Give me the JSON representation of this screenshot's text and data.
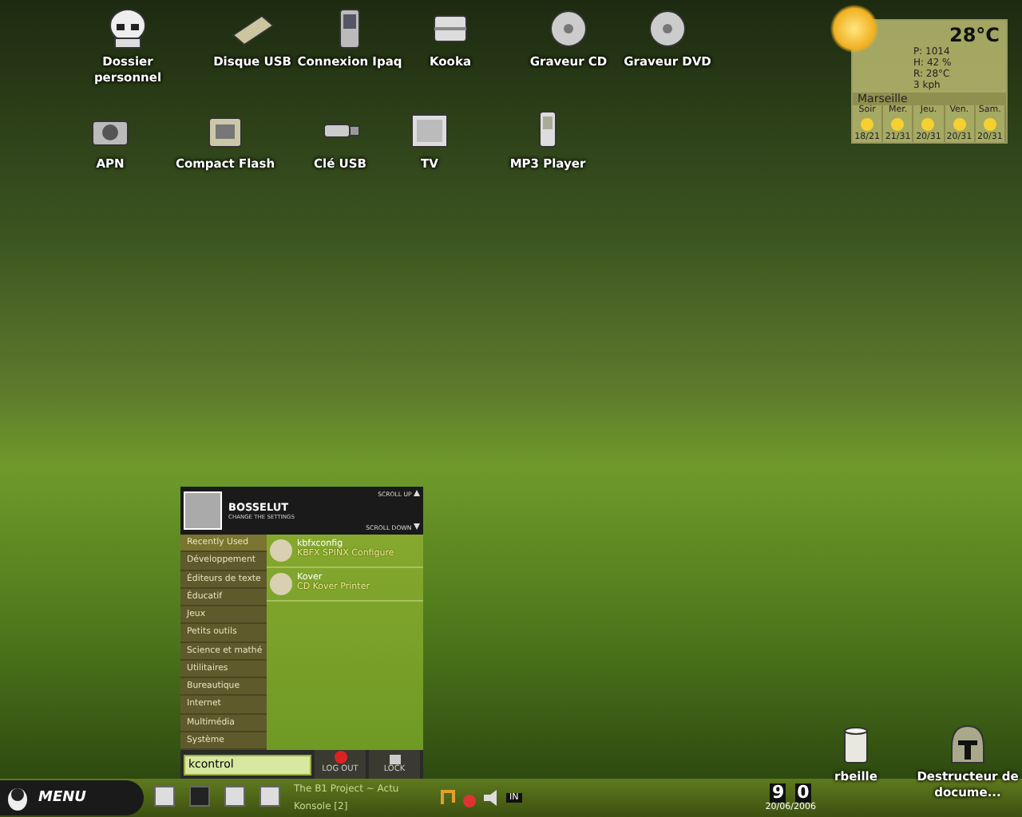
{
  "desktop_icons": [
    {
      "label": "Dossier personnel"
    },
    {
      "label": "Disque USB"
    },
    {
      "label": "Connexion Ipaq"
    },
    {
      "label": "Kooka"
    },
    {
      "label": "Graveur CD"
    },
    {
      "label": "Graveur DVD"
    },
    {
      "label": "APN"
    },
    {
      "label": "Compact Flash"
    },
    {
      "label": "Clé USB"
    },
    {
      "label": "TV"
    },
    {
      "label": "MP3 Player"
    },
    {
      "label": "rbeille"
    },
    {
      "label": "Destructeur de docume..."
    }
  ],
  "weather": {
    "temperature": "28°C",
    "pressure": "P: 1014",
    "humidity": "H: 42 %",
    "feels": "R: 28°C",
    "wind": "3 kph",
    "city": "Marseille",
    "days": [
      {
        "name": "Soir",
        "temps": "18/21"
      },
      {
        "name": "Mer.",
        "temps": "21/31"
      },
      {
        "name": "Jeu.",
        "temps": "20/31"
      },
      {
        "name": "Ven.",
        "temps": "20/31"
      },
      {
        "name": "Sam.",
        "temps": "20/31"
      }
    ]
  },
  "menu": {
    "user": "BOSSELUT",
    "subtitle": "CHANGE THE SETTINGS",
    "scroll_up": "SCROLL UP",
    "scroll_down": "SCROLL DOWN",
    "categories": [
      {
        "label": "Recently Used",
        "selected": true
      },
      {
        "label": "Développement",
        "selected": false
      },
      {
        "label": "Éditeurs de texte",
        "selected": false
      },
      {
        "label": "Éducatif",
        "selected": false
      },
      {
        "label": "Jeux",
        "selected": false
      },
      {
        "label": "Petits outils",
        "selected": false
      },
      {
        "label": "Science et mathé",
        "selected": false
      },
      {
        "label": "Utilitaires",
        "selected": false
      },
      {
        "label": "Bureautique",
        "selected": false
      },
      {
        "label": "Internet",
        "selected": false
      },
      {
        "label": "Multimédia",
        "selected": false
      },
      {
        "label": "Système",
        "selected": false
      }
    ],
    "apps": [
      {
        "name": "kbfxconfig",
        "description": "KBFX SPINX Configure"
      },
      {
        "name": "Kover",
        "description": "CD Kover Printer"
      }
    ],
    "search": {
      "value": "kcontrol"
    },
    "logout": "LOG OUT",
    "lock": "LOCK"
  },
  "taskbar": {
    "menu_button": "MENU",
    "tasks": [
      "The B1 Project ~ Actu",
      "Konsole [2]"
    ],
    "tray_label": "IN",
    "clock_hour": "9",
    "clock_minute": "0",
    "date": "20/06/2006"
  }
}
